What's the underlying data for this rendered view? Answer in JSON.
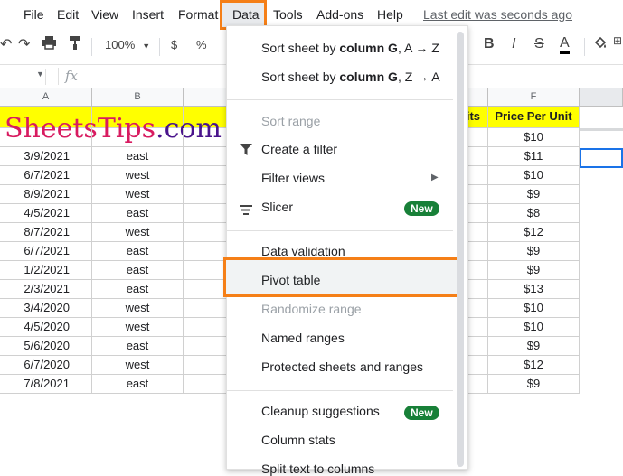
{
  "menubar": {
    "items": [
      "File",
      "Edit",
      "View",
      "Insert",
      "Format",
      "Data",
      "Tools",
      "Add-ons",
      "Help"
    ],
    "active": "Data",
    "last_edit": "Last edit was seconds ago"
  },
  "toolbar": {
    "zoom": "100%",
    "currency": "$",
    "percent": "%",
    "bold": "B",
    "italic": "I",
    "strike": "S",
    "text_color": "A"
  },
  "formula_bar": {
    "fx": "fx",
    "cell_ref": ""
  },
  "columns": [
    "A",
    "B",
    "F"
  ],
  "header_row": {
    "logo_red": "SheetsTips",
    "logo_purple": ".com",
    "e_header_fragment": "its",
    "f_header": "Price Per Unit"
  },
  "rows": [
    {
      "date": "",
      "region": "",
      "price": "$10"
    },
    {
      "date": "3/9/2021",
      "region": "east",
      "price": "$11"
    },
    {
      "date": "6/7/2021",
      "region": "west",
      "price": "$10"
    },
    {
      "date": "8/9/2021",
      "region": "west",
      "price": "$9"
    },
    {
      "date": "4/5/2021",
      "region": "east",
      "price": "$8"
    },
    {
      "date": "8/7/2021",
      "region": "west",
      "price": "$12"
    },
    {
      "date": "6/7/2021",
      "region": "east",
      "price": "$9"
    },
    {
      "date": "1/2/2021",
      "region": "east",
      "price": "$9"
    },
    {
      "date": "2/3/2021",
      "region": "east",
      "price": "$13"
    },
    {
      "date": "3/4/2020",
      "region": "west",
      "price": "$10"
    },
    {
      "date": "4/5/2020",
      "region": "west",
      "price": "$10"
    },
    {
      "date": "5/6/2020",
      "region": "east",
      "price": "$9"
    },
    {
      "date": "6/7/2020",
      "region": "west",
      "price": "$12"
    },
    {
      "date": "7/8/2021",
      "region": "east",
      "price": "$9"
    }
  ],
  "data_menu": {
    "sort_asc_prefix": "Sort sheet by ",
    "sort_asc_bold": "column G",
    "sort_asc_suffix": ", A → Z",
    "sort_desc_prefix": "Sort sheet by ",
    "sort_desc_bold": "column G",
    "sort_desc_suffix": ", Z → A",
    "sort_range": "Sort range",
    "create_filter": "Create a filter",
    "filter_views": "Filter views",
    "slicer": "Slicer",
    "slicer_badge": "New",
    "data_validation": "Data validation",
    "pivot_table": "Pivot table",
    "randomize_range": "Randomize range",
    "named_ranges": "Named ranges",
    "protected": "Protected sheets and ranges",
    "cleanup": "Cleanup suggestions",
    "cleanup_badge": "New",
    "column_stats": "Column stats",
    "split_text": "Split text to columns"
  },
  "colors": {
    "highlight": "#f57f17",
    "badge": "#188038",
    "header_fill": "#ffff00"
  }
}
